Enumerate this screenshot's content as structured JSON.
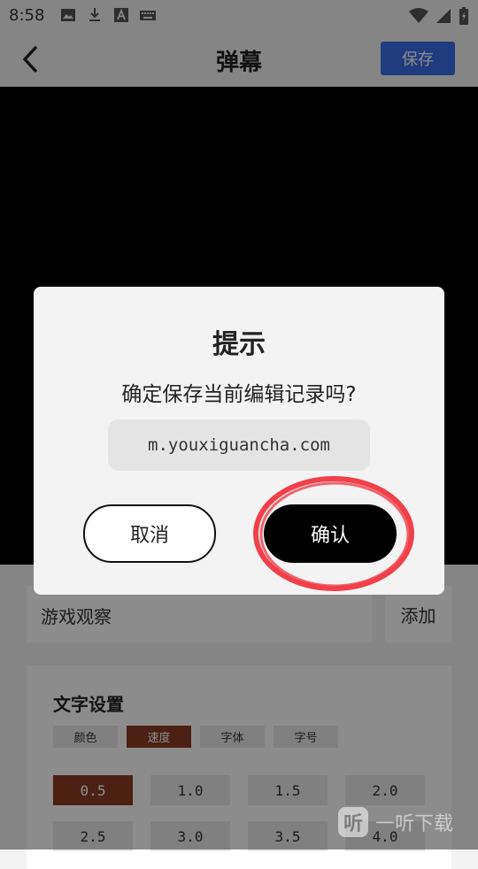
{
  "status_bar": {
    "time": "8:58",
    "icons": [
      "image-icon",
      "download-icon",
      "font-icon",
      "keyboard-icon",
      "wifi-icon",
      "signal-icon",
      "battery-icon"
    ]
  },
  "header": {
    "title": "弹幕",
    "save_label": "保存",
    "accent": "#3a6ee8"
  },
  "form": {
    "input_value": "游戏观察",
    "add_label": "添加"
  },
  "text_settings": {
    "title": "文字设置",
    "tabs": [
      "颜色",
      "速度",
      "字体",
      "字号"
    ],
    "active_tab": "速度",
    "speeds": [
      "0.5",
      "1.0",
      "1.5",
      "2.0",
      "2.5",
      "3.0",
      "3.5",
      "4.0"
    ],
    "active_speed": "0.5",
    "active_color": "#8a3b24"
  },
  "dialog": {
    "title": "提示",
    "message": "确定保存当前编辑记录吗?",
    "url": "m.youxiguancha.com",
    "cancel_label": "取消",
    "confirm_label": "确认",
    "annotation_color": "#f0404a"
  },
  "watermark": {
    "logo_char": "听",
    "text": "一听下载"
  }
}
